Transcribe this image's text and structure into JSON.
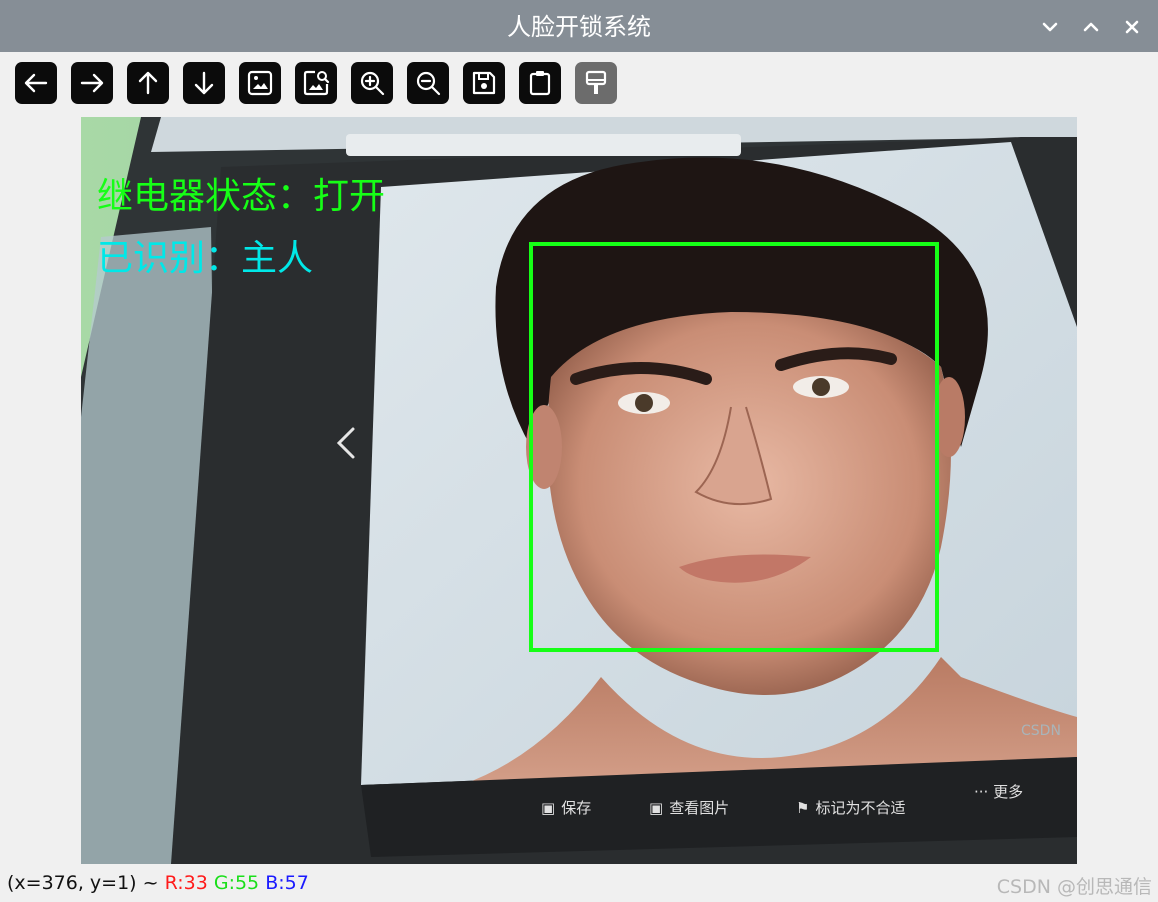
{
  "window": {
    "title": "人脸开锁系统",
    "controls": [
      "chevron-down-icon",
      "chevron-up-icon",
      "close-icon"
    ]
  },
  "toolbar": {
    "buttons": [
      {
        "icon": "arrow-left-icon",
        "enabled": true
      },
      {
        "icon": "arrow-right-icon",
        "enabled": true
      },
      {
        "icon": "arrow-up-icon",
        "enabled": true
      },
      {
        "icon": "arrow-down-icon",
        "enabled": true
      },
      {
        "icon": "image-icon",
        "enabled": true
      },
      {
        "icon": "image-search-icon",
        "enabled": true
      },
      {
        "icon": "zoom-in-icon",
        "enabled": true
      },
      {
        "icon": "zoom-out-icon",
        "enabled": true
      },
      {
        "icon": "save-icon",
        "enabled": true
      },
      {
        "icon": "clipboard-icon",
        "enabled": true
      },
      {
        "icon": "paint-brush-icon",
        "enabled": false
      }
    ]
  },
  "overlay": {
    "relay_status": "继电器状态：打开",
    "relay_color": "#16ff16",
    "recognized": "已识别：主人",
    "recognized_color": "#00e8e8",
    "face_box_color": "#16ff16"
  },
  "photo_viewer": {
    "actions": [
      "保存",
      "查看图片",
      "标记为不合适",
      "··· 更多"
    ]
  },
  "statusbar": {
    "coords": "(x=376, y=1) ~",
    "r": "R:33",
    "g": "G:55",
    "b": "B:57",
    "r_color": "#ff1a1a",
    "g_color": "#1adf1a",
    "b_color": "#1a1aff"
  },
  "watermark": "CSDN @创思通信"
}
